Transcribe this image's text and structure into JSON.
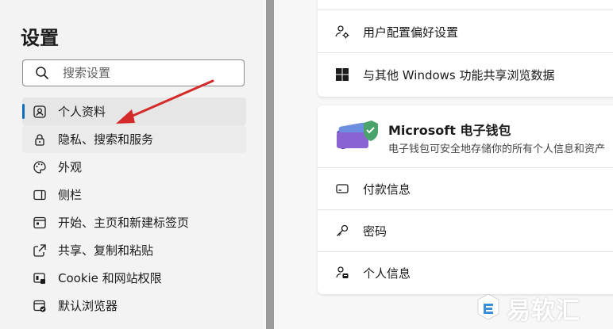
{
  "sidebar": {
    "title": "设置",
    "search_placeholder": "搜索设置",
    "items": [
      {
        "label": "个人资料",
        "icon": "profile-icon"
      },
      {
        "label": "隐私、搜索和服务",
        "icon": "lock-icon"
      },
      {
        "label": "外观",
        "icon": "palette-icon"
      },
      {
        "label": "侧栏",
        "icon": "sidebar-icon"
      },
      {
        "label": "开始、主页和新建标签页",
        "icon": "home-tabs-icon"
      },
      {
        "label": "共享、复制和粘贴",
        "icon": "share-icon"
      },
      {
        "label": "Cookie 和网站权限",
        "icon": "site-permissions-icon"
      },
      {
        "label": "默认浏览器",
        "icon": "default-browser-icon"
      }
    ]
  },
  "profile_card": {
    "rows": [
      {
        "label": "用户配置偏好设置",
        "icon": "profile-preferences-icon"
      },
      {
        "label": "与其他 Windows 功能共享浏览数据",
        "icon": "windows-icon"
      }
    ]
  },
  "wallet_card": {
    "title": "Microsoft 电子钱包",
    "description": "电子钱包可安全地存储你的所有个人信息和资产",
    "rows": [
      {
        "label": "付款信息",
        "icon": "credit-card-icon"
      },
      {
        "label": "密码",
        "icon": "key-icon"
      },
      {
        "label": "个人信息",
        "icon": "personal-info-icon"
      }
    ]
  },
  "watermark": {
    "text": "易软汇"
  },
  "colors": {
    "accent": "#0f6cbd",
    "annotation_arrow": "#d42a2a"
  }
}
